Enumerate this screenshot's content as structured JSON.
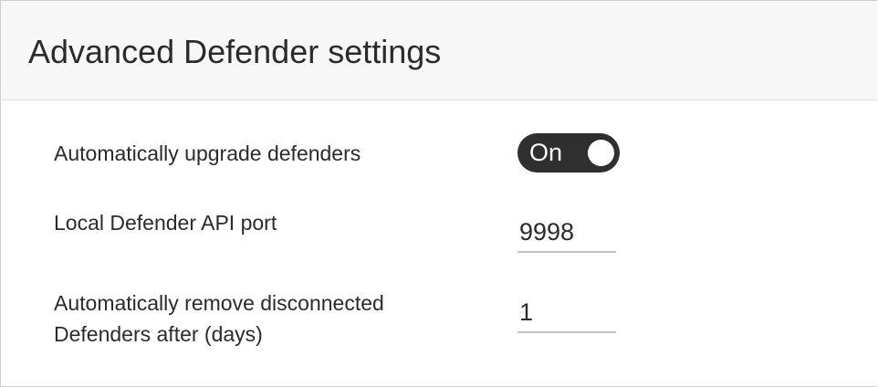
{
  "header": {
    "title": "Advanced Defender settings"
  },
  "settings": {
    "auto_upgrade": {
      "label": "Automatically upgrade defenders",
      "toggle_text": "On",
      "state": "on"
    },
    "api_port": {
      "label": "Local Defender API port",
      "value": "9998"
    },
    "remove_disconnected": {
      "label_line1": "Automatically remove disconnected",
      "label_line2": "Defenders after (days)",
      "value": "1"
    }
  },
  "colors": {
    "toggle_on": "#2f2f2f",
    "header_bg": "#f7f7f7",
    "text": "#2b2b2b"
  }
}
